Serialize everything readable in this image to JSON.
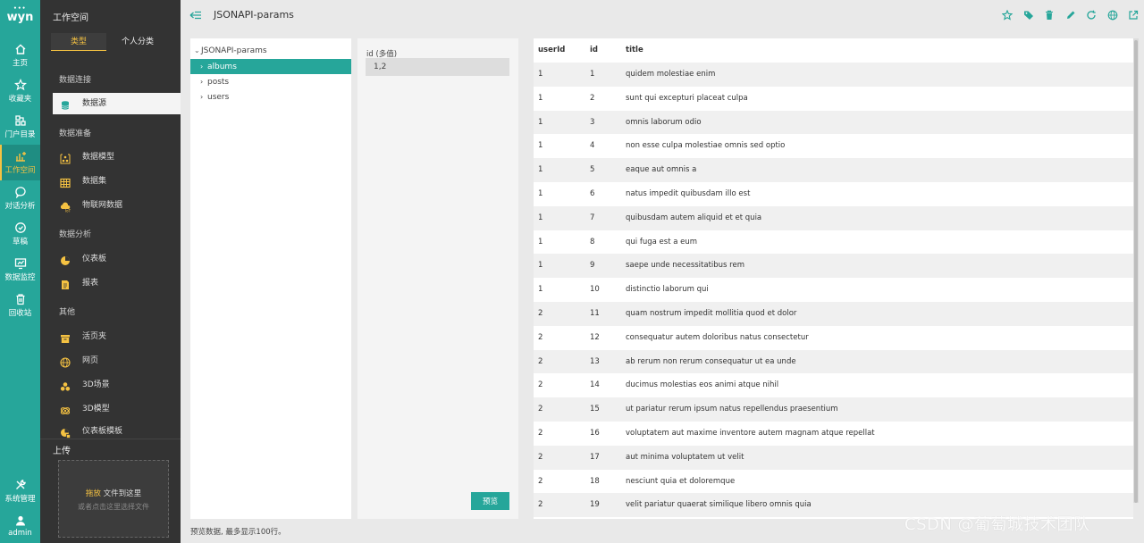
{
  "app": {
    "logo_text": "wyn",
    "logo_dots": "•••"
  },
  "rail": {
    "items": [
      {
        "label": "主页",
        "icon": "home-icon"
      },
      {
        "label": "收藏夹",
        "icon": "star-icon"
      },
      {
        "label": "门户目录",
        "icon": "portal-icon"
      },
      {
        "label": "工作空间",
        "icon": "workspace-icon",
        "active": true
      },
      {
        "label": "对话分析",
        "icon": "chat-icon"
      },
      {
        "label": "草稿",
        "icon": "draft-icon"
      },
      {
        "label": "数据监控",
        "icon": "monitor-icon"
      },
      {
        "label": "回收站",
        "icon": "trash-icon"
      },
      {
        "label": "系统管理",
        "icon": "tools-icon"
      },
      {
        "label": "admin",
        "icon": "user-icon"
      }
    ]
  },
  "sidebar": {
    "title": "工作空间",
    "tabs": [
      {
        "label": "类型",
        "active": true
      },
      {
        "label": "个人分类"
      }
    ],
    "groups": {
      "g1": "数据连接",
      "g2": "数据准备",
      "g3": "数据分析",
      "g4": "其他"
    },
    "items": [
      {
        "label": "数据源",
        "icon": "database-icon",
        "active": true
      },
      {
        "label": "数据模型",
        "icon": "data-model-icon"
      },
      {
        "label": "数据集",
        "icon": "dataset-icon"
      },
      {
        "label": "物联网数据",
        "icon": "iot-icon"
      },
      {
        "label": "仪表板",
        "icon": "dashboard-icon"
      },
      {
        "label": "报表",
        "icon": "report-icon"
      },
      {
        "label": "活页夹",
        "icon": "binder-icon"
      },
      {
        "label": "网页",
        "icon": "web-icon"
      },
      {
        "label": "3D场景",
        "icon": "3d-scene-icon"
      },
      {
        "label": "3D模型",
        "icon": "3d-model-icon"
      },
      {
        "label": "仪表板模板",
        "icon": "dashboard-template-icon"
      }
    ],
    "upload": {
      "title": "上传",
      "drop_highlight": "拖放",
      "drop_text": "文件到这里",
      "hint": "或者点击这里选择文件"
    }
  },
  "header": {
    "title": "JSONAPI-params",
    "actions": [
      "star-icon",
      "tag-icon",
      "delete-icon",
      "edit-icon",
      "refresh-icon",
      "globe-icon",
      "open-external-icon"
    ]
  },
  "tree": {
    "root": "JSONAPI-params",
    "nodes": [
      {
        "label": "albums",
        "active": true
      },
      {
        "label": "posts"
      },
      {
        "label": "users"
      }
    ]
  },
  "params": {
    "label": "id (多值)",
    "value": "1,2",
    "preview_button": "预览"
  },
  "grid": {
    "columns": [
      "userId",
      "id",
      "title"
    ],
    "rows": [
      [
        "1",
        "1",
        "quidem molestiae enim"
      ],
      [
        "1",
        "2",
        "sunt qui excepturi placeat culpa"
      ],
      [
        "1",
        "3",
        "omnis laborum odio"
      ],
      [
        "1",
        "4",
        "non esse culpa molestiae omnis sed optio"
      ],
      [
        "1",
        "5",
        "eaque aut omnis a"
      ],
      [
        "1",
        "6",
        "natus impedit quibusdam illo est"
      ],
      [
        "1",
        "7",
        "quibusdam autem aliquid et et quia"
      ],
      [
        "1",
        "8",
        "qui fuga est a eum"
      ],
      [
        "1",
        "9",
        "saepe unde necessitatibus rem"
      ],
      [
        "1",
        "10",
        "distinctio laborum qui"
      ],
      [
        "2",
        "11",
        "quam nostrum impedit mollitia quod et dolor"
      ],
      [
        "2",
        "12",
        "consequatur autem doloribus natus consectetur"
      ],
      [
        "2",
        "13",
        "ab rerum non rerum consequatur ut ea unde"
      ],
      [
        "2",
        "14",
        "ducimus molestias eos animi atque nihil"
      ],
      [
        "2",
        "15",
        "ut pariatur rerum ipsum natus repellendus praesentium"
      ],
      [
        "2",
        "16",
        "voluptatem aut maxime inventore autem magnam atque repellat"
      ],
      [
        "2",
        "17",
        "aut minima voluptatem ut velit"
      ],
      [
        "2",
        "18",
        "nesciunt quia et doloremque"
      ],
      [
        "2",
        "19",
        "velit pariatur quaerat similique libero omnis quia"
      ]
    ]
  },
  "footer": {
    "note": "预览数据, 最多显示100行。"
  },
  "watermark": "CSDN @葡萄城技术团队",
  "colors": {
    "accent": "#26a69a",
    "highlight": "#f5c242",
    "sidebar_bg": "#333333"
  }
}
